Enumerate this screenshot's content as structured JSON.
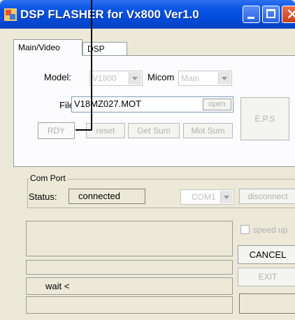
{
  "window": {
    "title": "DSP FLASHER for Vx800  Ver1.0",
    "icons": [
      "app-icon",
      "minimize-icon",
      "maximize-icon",
      "close-icon"
    ]
  },
  "tabs": [
    {
      "label": "Main/Video",
      "selected": true
    },
    {
      "label": "DSP",
      "selected": false
    }
  ],
  "main": {
    "model_label": "Model:",
    "model_value": "V1800",
    "micom_label": "Micom",
    "micom_value": "Main",
    "file_label": "File",
    "file_value": "V18MZ027.MOT",
    "open_label": "open",
    "eps_label": "E.P.S",
    "rdy_label": "RDY",
    "reset_label": "reset",
    "getsum_label": "Get Sum",
    "motsum_label": "Mot Sum"
  },
  "com_port": {
    "group_title": "Com Port",
    "status_label": "Status:",
    "status_value": "connected",
    "port_value": "COM1",
    "disconnect_label": "disconnect"
  },
  "log": {
    "message": "wait <"
  },
  "controls": {
    "speed_label": "speed up",
    "cancel_label": "CANCEL",
    "exit_label": "EXIT"
  },
  "colors": {
    "titlebar": "#0049d6",
    "window_bg": "#ece9d8",
    "annotation_line": "#000000"
  }
}
